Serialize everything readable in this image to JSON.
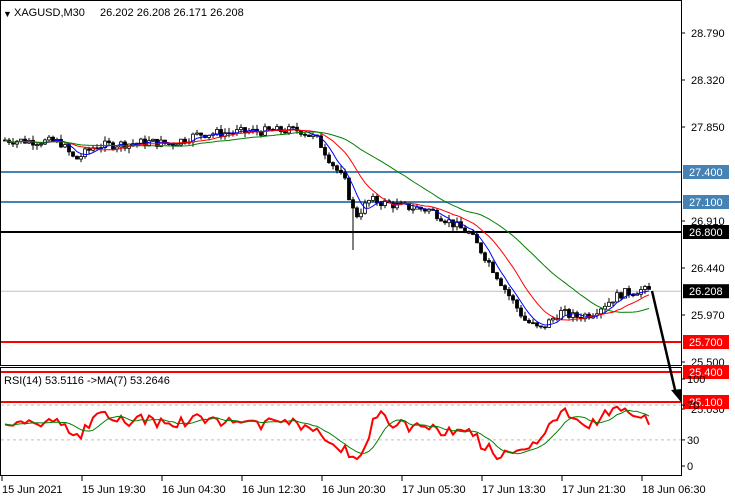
{
  "header": {
    "menu_arrow": "▼",
    "symbol": "XAGUSD,M30",
    "ohlc": "26.202 26.208 26.171 26.208"
  },
  "main_chart": {
    "price_axis": [
      "28.790",
      "28.320",
      "27.850",
      "26.910",
      "26.440",
      "25.970",
      "25.500",
      "25.030"
    ],
    "tags": [
      {
        "label": "27.400",
        "price": 27.4,
        "color": "#4682b4"
      },
      {
        "label": "27.100",
        "price": 27.1,
        "color": "#4682b4"
      },
      {
        "label": "26.800",
        "price": 26.8,
        "color": "#000000"
      },
      {
        "label": "26.208",
        "price": 26.208,
        "color": "#000000"
      },
      {
        "label": "25.700",
        "price": 25.7,
        "color": "#ff0000"
      },
      {
        "label": "25.400",
        "price": 25.4,
        "color": "#ff0000"
      },
      {
        "label": "25.100",
        "price": 25.1,
        "color": "#ff0000"
      }
    ],
    "colors": {
      "bull": "#ffffff",
      "bear": "#000000",
      "ma_fast": "#0000ff",
      "ma_mid": "#ff0000",
      "ma_slow": "#008000",
      "support_line": "#4682b4",
      "pivot_line": "#000000",
      "target_line": "#ff0000",
      "current_price_line": "#c0c0c0",
      "arrow": "#000000"
    }
  },
  "rsi_panel": {
    "indicator_label": "RSI(14) 53.5116 ->MA(7) 53.2646",
    "axis": [
      "100",
      "70",
      "30",
      "0"
    ],
    "levels": [
      70,
      30
    ],
    "colors": {
      "rsi": "#ff0000",
      "ma": "#008000"
    }
  },
  "time_axis": [
    "15 Jun 2021",
    "15 Jun 19:30",
    "16 Jun 04:30",
    "16 Jun 12:30",
    "16 Jun 20:30",
    "17 Jun 05:30",
    "17 Jun 13:30",
    "17 Jun 21:30",
    "18 Jun 06:30"
  ]
}
